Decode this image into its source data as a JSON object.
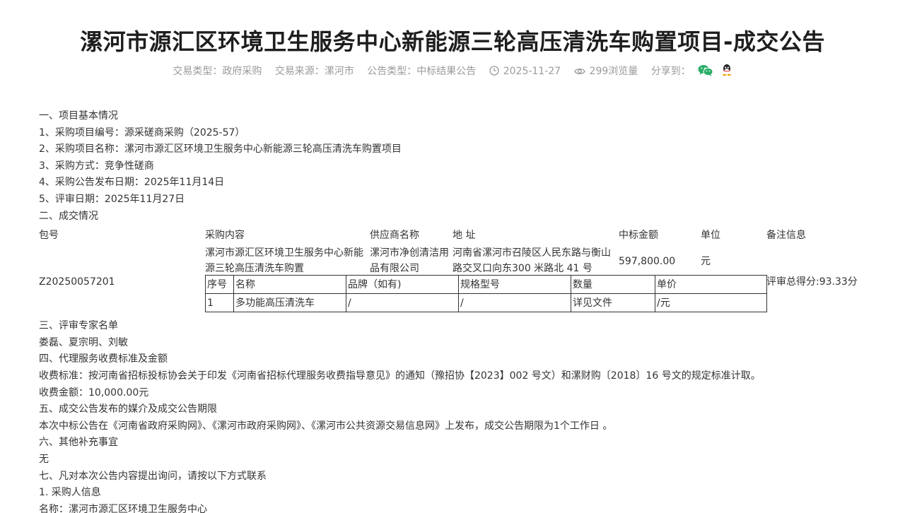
{
  "title": "漯河市源汇区环境卫生服务中心新能源三轮高压清洗车购置项目-成交公告",
  "meta": {
    "trade_type": "交易类型：政府采购",
    "trade_source": "交易来源：漯河市",
    "notice_type": "公告类型：中标结果公告",
    "date": "2025-11-27",
    "views": "299浏览量",
    "share_label": "分享到：",
    "icons": {
      "clock": "clock-icon",
      "eye": "eye-icon",
      "wechat": "wechat-icon",
      "qq": "qq-icon"
    },
    "colors": {
      "wechat": "#2aae67",
      "meta_text": "#9a9a9a"
    }
  },
  "lines_top": [
    "一、项目基本情况",
    "1、采购项目编号：源采磋商采购（2025-57）",
    "2、采购项目名称：漯河市源汇区环境卫生服务中心新能源三轮高压清洗车购置项目",
    "3、采购方式：竞争性磋商",
    "4、采购公告发布日期：2025年11月14日",
    "5、评审日期：2025年11月27日",
    "二、成交情况"
  ],
  "result_table": {
    "headers": {
      "package": "包号",
      "content": "采购内容",
      "supplier": "供应商名称",
      "address": "地 址",
      "amount": "中标金额",
      "unit": "单位",
      "remark": "备注信息"
    },
    "row": {
      "package": "Z20250057201",
      "content": "漯河市源汇区环境卫生服务中心新能源三轮高压清洗车购置",
      "supplier": "漯河市净创清洁用品有限公司",
      "address": "河南省漯河市召陵区人民东路与衡山路交叉口向东300 米路北 41 号",
      "amount": "597,800.00",
      "unit": "元",
      "remark": "评审总得分:93.33分"
    },
    "sub_headers": [
      "序号",
      "名称",
      "品牌（如有)",
      "规格型号",
      "数量",
      "单价"
    ],
    "sub_rows": [
      [
        "1",
        "多功能高压清洗车",
        "/",
        "/",
        "详见文件",
        "/元"
      ]
    ]
  },
  "lines_bottom": [
    "三、评审专家名单",
    "娄磊、夏宗明、刘敏",
    "四、代理服务收费标准及金额",
    "收费标准：按河南省招标投标协会关于印发《河南省招标代理服务收费指导意见》的通知（豫招协【2023】002 号文）和漯财购〔2018〕16 号文的规定标准计取。",
    "收费金额：10,000.00元",
    "五、成交公告发布的媒介及成交公告期限",
    "本次中标公告在《河南省政府采购网》、《漯河市政府采购网》、《漯河市公共资源交易信息网》上发布，成交公告期限为1个工作日 。",
    "六、其他补充事宜",
    "无",
    "七、凡对本次公告内容提出询问，请按以下方式联系",
    "1. 采购人信息",
    "名称：漯河市源汇区环境卫生服务中心"
  ]
}
